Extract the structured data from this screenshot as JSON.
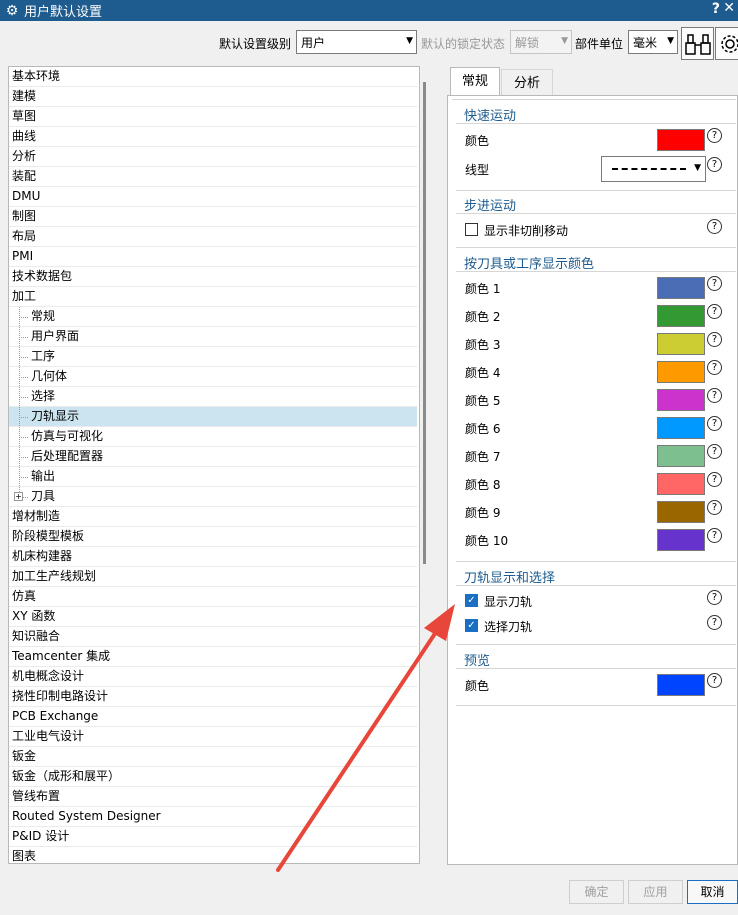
{
  "window": {
    "title": "用户默认设置",
    "help": "?",
    "close": "✕"
  },
  "toolbar": {
    "level_label": "默认设置级别",
    "level_value": "用户",
    "lock_label": "默认的锁定状态",
    "lock_value": "解锁",
    "unit_label": "部件单位",
    "unit_value": "毫米"
  },
  "tree": {
    "items": [
      {
        "label": "基本环境"
      },
      {
        "label": "建模"
      },
      {
        "label": "草图"
      },
      {
        "label": "曲线"
      },
      {
        "label": "分析"
      },
      {
        "label": "装配"
      },
      {
        "label": "DMU"
      },
      {
        "label": "制图"
      },
      {
        "label": "布局"
      },
      {
        "label": "PMI"
      },
      {
        "label": "技术数据包"
      },
      {
        "label": "加工"
      },
      {
        "label": "常规"
      },
      {
        "label": "用户界面"
      },
      {
        "label": "工序"
      },
      {
        "label": "几何体"
      },
      {
        "label": "选择"
      },
      {
        "label": "刀轨显示"
      },
      {
        "label": "仿真与可视化"
      },
      {
        "label": "后处理配置器"
      },
      {
        "label": "输出"
      },
      {
        "label": "刀具"
      },
      {
        "label": "增材制造"
      },
      {
        "label": "阶段模型模板"
      },
      {
        "label": "机床构建器"
      },
      {
        "label": "加工生产线规划"
      },
      {
        "label": "仿真"
      },
      {
        "label": "XY 函数"
      },
      {
        "label": "知识融合"
      },
      {
        "label": "Teamcenter 集成"
      },
      {
        "label": "机电概念设计"
      },
      {
        "label": "挠性印制电路设计"
      },
      {
        "label": "PCB Exchange"
      },
      {
        "label": "工业电气设计"
      },
      {
        "label": "钣金"
      },
      {
        "label": "钣金（成形和展平）"
      },
      {
        "label": "管线布置"
      },
      {
        "label": "Routed System Designer"
      },
      {
        "label": "P&ID 设计"
      },
      {
        "label": "图表"
      }
    ]
  },
  "tabs": [
    {
      "label": "常规"
    },
    {
      "label": "分析"
    }
  ],
  "panel": {
    "rapid": {
      "title": "快速运动",
      "color_label": "颜色",
      "color": "#ff0000",
      "linetype_label": "线型"
    },
    "stepover": {
      "title": "步进运动",
      "noncut_label": "显示非切削移动"
    },
    "tool_colors": {
      "title": "按刀具或工序显示颜色",
      "items": [
        {
          "label": "颜色 1",
          "color": "#4b6db5"
        },
        {
          "label": "颜色 2",
          "color": "#339933"
        },
        {
          "label": "颜色 3",
          "color": "#cccc33"
        },
        {
          "label": "颜色 4",
          "color": "#ff9900"
        },
        {
          "label": "颜色 5",
          "color": "#cc33cc"
        },
        {
          "label": "颜色 6",
          "color": "#0099ff"
        },
        {
          "label": "颜色 7",
          "color": "#7dbf8e"
        },
        {
          "label": "颜色 8",
          "color": "#ff6666"
        },
        {
          "label": "颜色 9",
          "color": "#996600"
        },
        {
          "label": "颜色 10",
          "color": "#6633cc"
        }
      ]
    },
    "toolpath": {
      "title": "刀轨显示和选择",
      "show_label": "显示刀轨",
      "select_label": "选择刀轨"
    },
    "preview": {
      "title": "预览",
      "color_label": "颜色",
      "color": "#0044ff"
    }
  },
  "buttons": {
    "ok": "确定",
    "apply": "应用",
    "cancel": "取消"
  },
  "annotation_color": "#e8463a"
}
